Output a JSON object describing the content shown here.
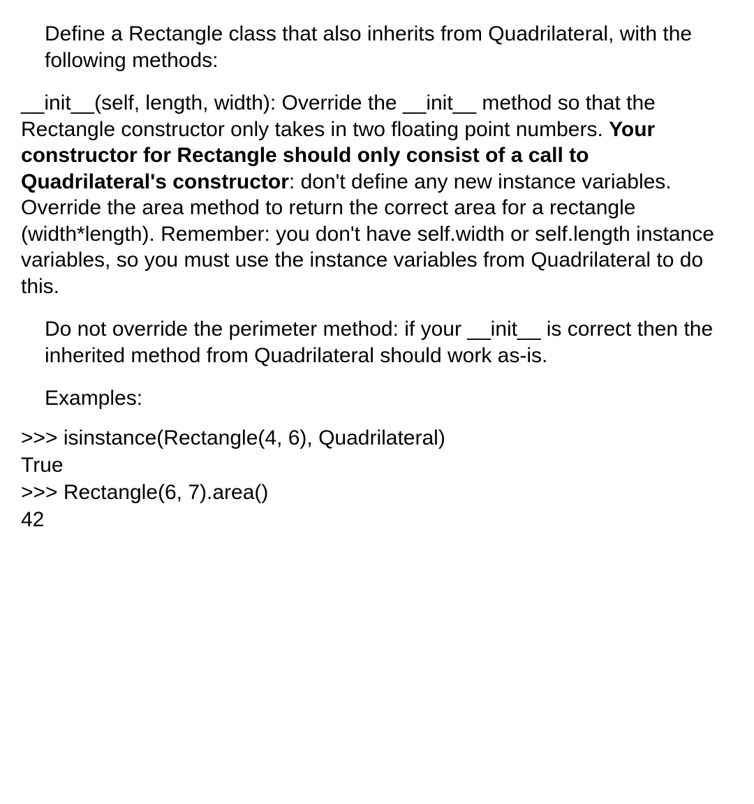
{
  "p1": "Define a Rectangle class that also inherits from Quadrilateral, with the following methods:",
  "p2a": "__init__(self, length, width): Override the __init__ method so that the Rectangle constructor only takes in two floating point numbers. ",
  "p2b": "Your constructor for Rectangle should only consist of a call to Quadrilateral's constructor",
  "p2c": ": don't define any new instance variables.",
  "p2d": "Override the area method to return the correct area for a rectangle (width*length). Remember: you don't have self.width or self.length instance variables, so you must use the instance variables from Quadrilateral to do this.",
  "p3": "Do not override the perimeter method: if your __init__ is correct then the inherited method from Quadrilateral should work as-is.",
  "examples_label": "Examples:",
  "code_line1": ">>> isinstance(Rectangle(4, 6), Quadrilateral)",
  "code_line2": "True",
  "code_line3": ">>> Rectangle(6, 7).area()",
  "code_line4": "42"
}
